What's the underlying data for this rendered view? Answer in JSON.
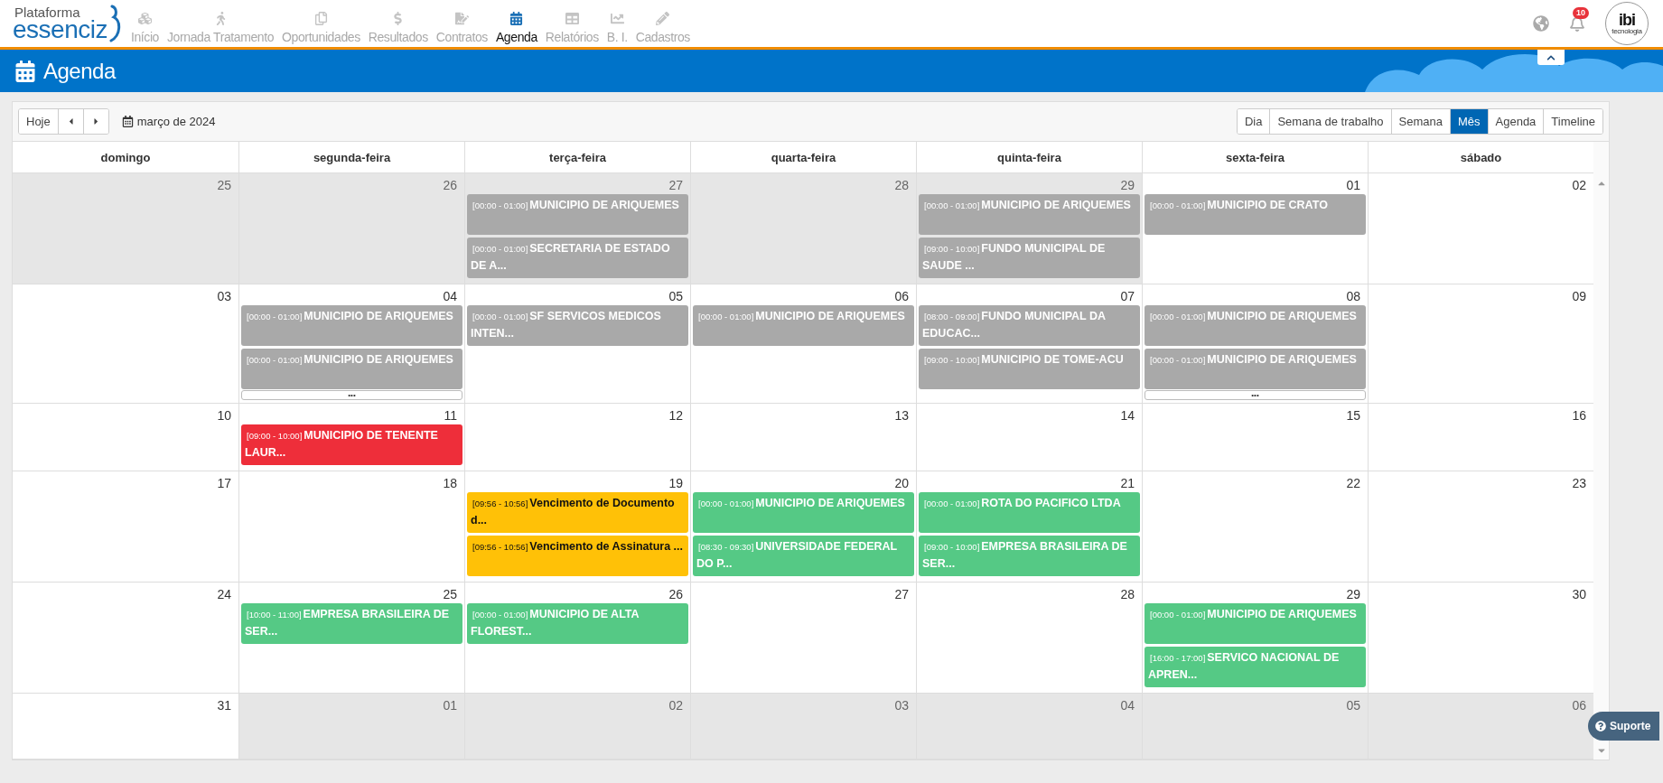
{
  "brand": {
    "top": "Plataforma",
    "name": "essenciz"
  },
  "nav": [
    {
      "label": "Início",
      "selected": false
    },
    {
      "label": "Jornada Tratamento",
      "selected": false
    },
    {
      "label": "Oportunidades",
      "selected": false
    },
    {
      "label": "Resultados",
      "selected": false
    },
    {
      "label": "Contratos",
      "selected": false
    },
    {
      "label": "Agenda",
      "selected": true
    },
    {
      "label": "Relatórios",
      "selected": false
    },
    {
      "label": "B. I.",
      "selected": false
    },
    {
      "label": "Cadastros",
      "selected": false
    }
  ],
  "notifications": {
    "count": "10"
  },
  "profile": {
    "logo": "ibi",
    "tagline": "tecnologia"
  },
  "page_title": "Agenda",
  "toolbar": {
    "today": "Hoje",
    "date": "março de 2024",
    "views": [
      {
        "label": "Dia",
        "selected": false
      },
      {
        "label": "Semana de trabalho",
        "selected": false
      },
      {
        "label": "Semana",
        "selected": false
      },
      {
        "label": "Mês",
        "selected": true
      },
      {
        "label": "Agenda",
        "selected": false
      },
      {
        "label": "Timeline",
        "selected": false
      }
    ]
  },
  "weekdays": [
    "domingo",
    "segunda-feira",
    "terça-feira",
    "quarta-feira",
    "quinta-feira",
    "sexta-feira",
    "sábado"
  ],
  "weeks": [
    [
      {
        "day": "25",
        "other_month": true
      },
      {
        "day": "26",
        "other_month": true
      },
      {
        "day": "27",
        "other_month": true,
        "events": [
          {
            "time": "[00:00 - 01:00]",
            "title": "MUNICIPIO DE ARIQUEMES",
            "color": "#a9a9a9"
          },
          {
            "time": "[00:00 - 01:00]",
            "title": "SECRETARIA DE ESTADO DE A...",
            "color": "#a9a9a9"
          }
        ]
      },
      {
        "day": "28",
        "other_month": true
      },
      {
        "day": "29",
        "other_month": true,
        "events": [
          {
            "time": "[00:00 - 01:00]",
            "title": "MUNICIPIO DE ARIQUEMES",
            "color": "#a9a9a9"
          },
          {
            "time": "[09:00 - 10:00]",
            "title": "FUNDO MUNICIPAL DE SAUDE ...",
            "color": "#a9a9a9"
          }
        ]
      },
      {
        "day": "01",
        "other_month": false,
        "events": [
          {
            "time": "[00:00 - 01:00]",
            "title": "MUNICIPIO DE CRATO",
            "color": "#a9a9a9"
          }
        ]
      },
      {
        "day": "02",
        "other_month": false
      }
    ],
    [
      {
        "day": "03",
        "other_month": false
      },
      {
        "day": "04",
        "other_month": false,
        "events": [
          {
            "time": "[00:00 - 01:00]",
            "title": "MUNICIPIO DE ARIQUEMES",
            "color": "#a9a9a9"
          },
          {
            "time": "[00:00 - 01:00]",
            "title": "MUNICIPIO DE ARIQUEMES",
            "color": "#a9a9a9"
          }
        ],
        "more": "•••"
      },
      {
        "day": "05",
        "other_month": false,
        "events": [
          {
            "time": "[00:00 - 01:00]",
            "title": "SF SERVICOS MEDICOS INTEN...",
            "color": "#a9a9a9"
          }
        ]
      },
      {
        "day": "06",
        "other_month": false,
        "events": [
          {
            "time": "[00:00 - 01:00]",
            "title": "MUNICIPIO DE ARIQUEMES",
            "color": "#a9a9a9"
          }
        ]
      },
      {
        "day": "07",
        "other_month": false,
        "events": [
          {
            "time": "[08:00 - 09:00]",
            "title": "FUNDO MUNICIPAL DA EDUCAC...",
            "color": "#a9a9a9"
          },
          {
            "time": "[09:00 - 10:00]",
            "title": "MUNICIPIO DE TOME-ACU",
            "color": "#a9a9a9"
          }
        ]
      },
      {
        "day": "08",
        "other_month": false,
        "events": [
          {
            "time": "[00:00 - 01:00]",
            "title": "MUNICIPIO DE ARIQUEMES",
            "color": "#a9a9a9"
          },
          {
            "time": "[00:00 - 01:00]",
            "title": "MUNICIPIO DE ARIQUEMES",
            "color": "#a9a9a9"
          }
        ],
        "more": "•••"
      },
      {
        "day": "09",
        "other_month": false
      }
    ],
    [
      {
        "day": "10",
        "other_month": false
      },
      {
        "day": "11",
        "other_month": false,
        "events": [
          {
            "time": "[09:00 - 10:00]",
            "title": "MUNICIPIO DE TENENTE LAUR...",
            "color": "#ee2e3a"
          }
        ]
      },
      {
        "day": "12",
        "other_month": false
      },
      {
        "day": "13",
        "other_month": false
      },
      {
        "day": "14",
        "other_month": false
      },
      {
        "day": "15",
        "other_month": false
      },
      {
        "day": "16",
        "other_month": false
      }
    ],
    [
      {
        "day": "17",
        "other_month": false
      },
      {
        "day": "18",
        "other_month": false
      },
      {
        "day": "19",
        "other_month": false,
        "events": [
          {
            "time": "[09:56 - 10:56]",
            "title": "Vencimento de Documento d...",
            "color": "#ffc107"
          },
          {
            "time": "[09:56 - 10:56]",
            "title": "Vencimento de Assinatura ...",
            "color": "#ffc107"
          }
        ]
      },
      {
        "day": "20",
        "other_month": false,
        "events": [
          {
            "time": "[00:00 - 01:00]",
            "title": "MUNICIPIO DE ARIQUEMES",
            "color": "#55c985"
          },
          {
            "time": "[08:30 - 09:30]",
            "title": "UNIVERSIDADE FEDERAL DO P...",
            "color": "#55c985"
          }
        ]
      },
      {
        "day": "21",
        "other_month": false,
        "events": [
          {
            "time": "[00:00 - 01:00]",
            "title": "ROTA DO PACIFICO LTDA",
            "color": "#55c985"
          },
          {
            "time": "[09:00 - 10:00]",
            "title": "EMPRESA BRASILEIRA DE SER...",
            "color": "#55c985"
          }
        ]
      },
      {
        "day": "22",
        "other_month": false
      },
      {
        "day": "23",
        "other_month": false
      }
    ],
    [
      {
        "day": "24",
        "other_month": false
      },
      {
        "day": "25",
        "other_month": false,
        "events": [
          {
            "time": "[10:00 - 11:00]",
            "title": "EMPRESA BRASILEIRA DE SER...",
            "color": "#55c985"
          }
        ]
      },
      {
        "day": "26",
        "other_month": false,
        "events": [
          {
            "time": "[00:00 - 01:00]",
            "title": "MUNICIPIO DE ALTA FLOREST...",
            "color": "#55c985"
          }
        ]
      },
      {
        "day": "27",
        "other_month": false
      },
      {
        "day": "28",
        "other_month": false
      },
      {
        "day": "29",
        "other_month": false,
        "events": [
          {
            "time": "[00:00 - 01:00]",
            "title": "MUNICIPIO DE ARIQUEMES",
            "color": "#55c985"
          },
          {
            "time": "[16:00 - 17:00]",
            "title": "SERVICO NACIONAL DE APREN...",
            "color": "#55c985"
          }
        ]
      },
      {
        "day": "30",
        "other_month": false
      }
    ],
    [
      {
        "day": "31",
        "other_month": false
      },
      {
        "day": "01",
        "other_month": true
      },
      {
        "day": "02",
        "other_month": true
      },
      {
        "day": "03",
        "other_month": true
      },
      {
        "day": "04",
        "other_month": true
      },
      {
        "day": "05",
        "other_month": true
      },
      {
        "day": "06",
        "other_month": true
      }
    ]
  ],
  "support": "Suporte"
}
